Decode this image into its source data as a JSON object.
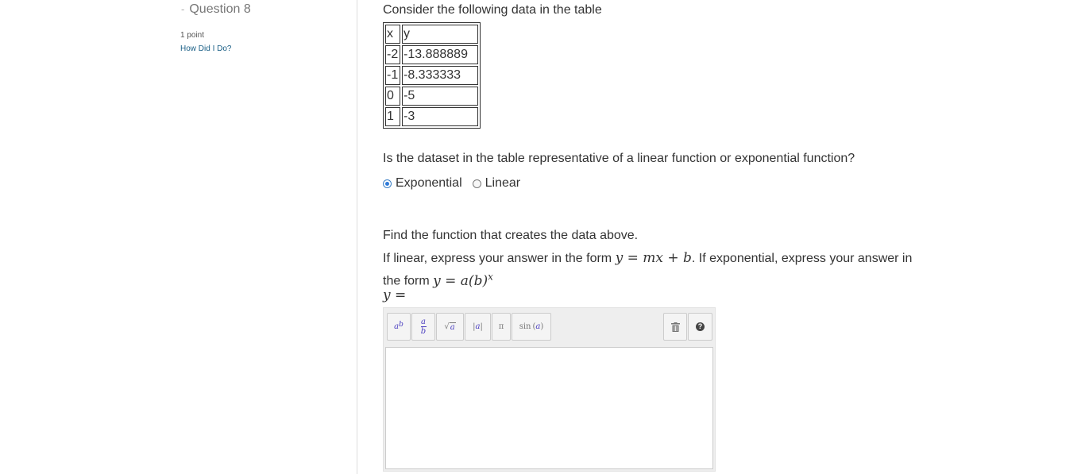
{
  "sidebar": {
    "question_label": "Question 8",
    "points": "1 point",
    "how_did_i_do": "How Did I Do?"
  },
  "question": {
    "intro": "Consider the following data in the table",
    "table": {
      "headers": [
        "x",
        "y"
      ],
      "rows": [
        [
          "-2",
          "-13.888889"
        ],
        [
          "-1",
          "-8.333333"
        ],
        [
          "0",
          "-5"
        ],
        [
          "1",
          "-3"
        ]
      ]
    },
    "prompt_type": "Is the dataset in the table representative of a linear function or exponential function?",
    "options": [
      "Exponential",
      "Linear"
    ],
    "selected_option": "Exponential",
    "find_prompt": "Find the function that creates the data above.",
    "form_text_1": "If linear, express your answer in the form ",
    "linear_form": "y = mx + b",
    "form_text_2": ". If exponential, express your answer in the form ",
    "exp_form": "y = a(b)",
    "exp_form_exponent": "x",
    "answer_label": "y ="
  },
  "editor": {
    "toolbar": {
      "power_base": "a",
      "power_exp": "b",
      "frac_num": "a",
      "frac_den": "b",
      "sqrt": "√",
      "sqrt_arg": "a",
      "abs_arg": "a",
      "pi": "π",
      "sin_fn": "sin",
      "sin_arg": "a",
      "trash_icon": "trash-icon",
      "help_icon": "question-icon",
      "help_glyph": "?"
    },
    "value": ""
  },
  "colors": {
    "link": "#1a5f86",
    "radio_selected": "#2f7bd9",
    "editor_symbol": "#4b3fc0"
  }
}
